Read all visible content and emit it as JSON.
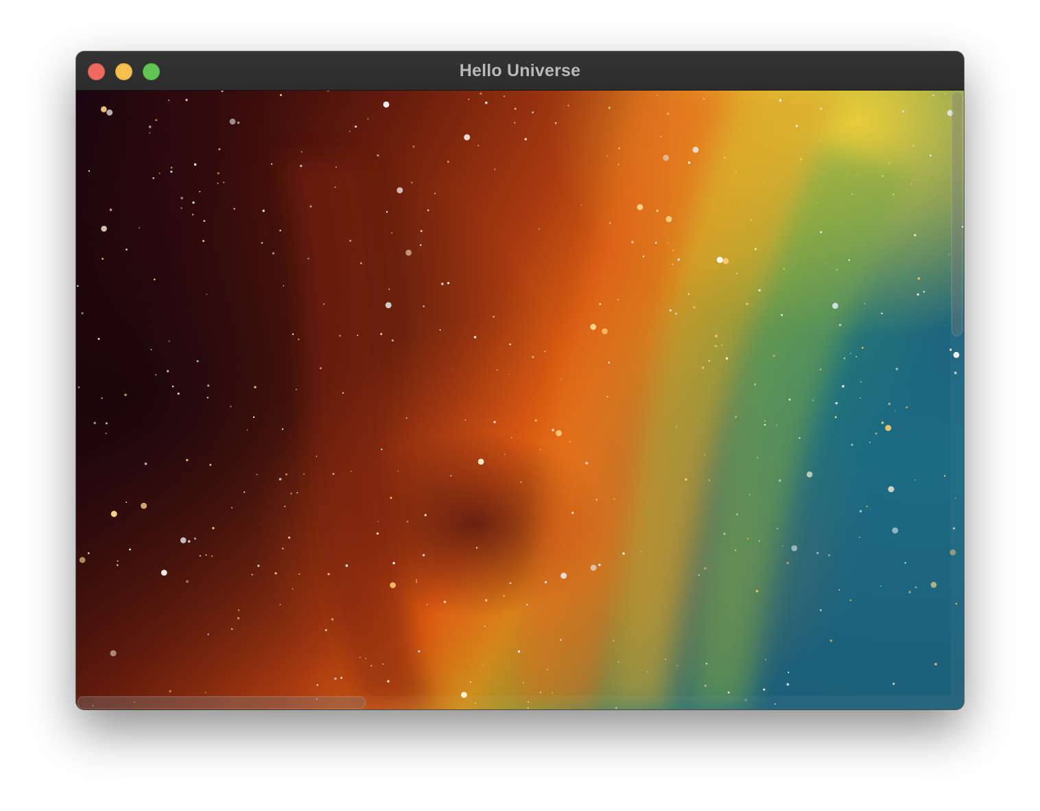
{
  "window": {
    "title": "Hello Universe"
  },
  "controls": {
    "close": "close-icon",
    "minimize": "minimize-icon",
    "zoom": "zoom-icon"
  },
  "colors": {
    "close": "#ed6a5e",
    "minimize": "#f5bf4f",
    "zoom": "#61c554",
    "titlebar": "#2f2f2f"
  },
  "content": {
    "image": "nebula-space-image"
  }
}
